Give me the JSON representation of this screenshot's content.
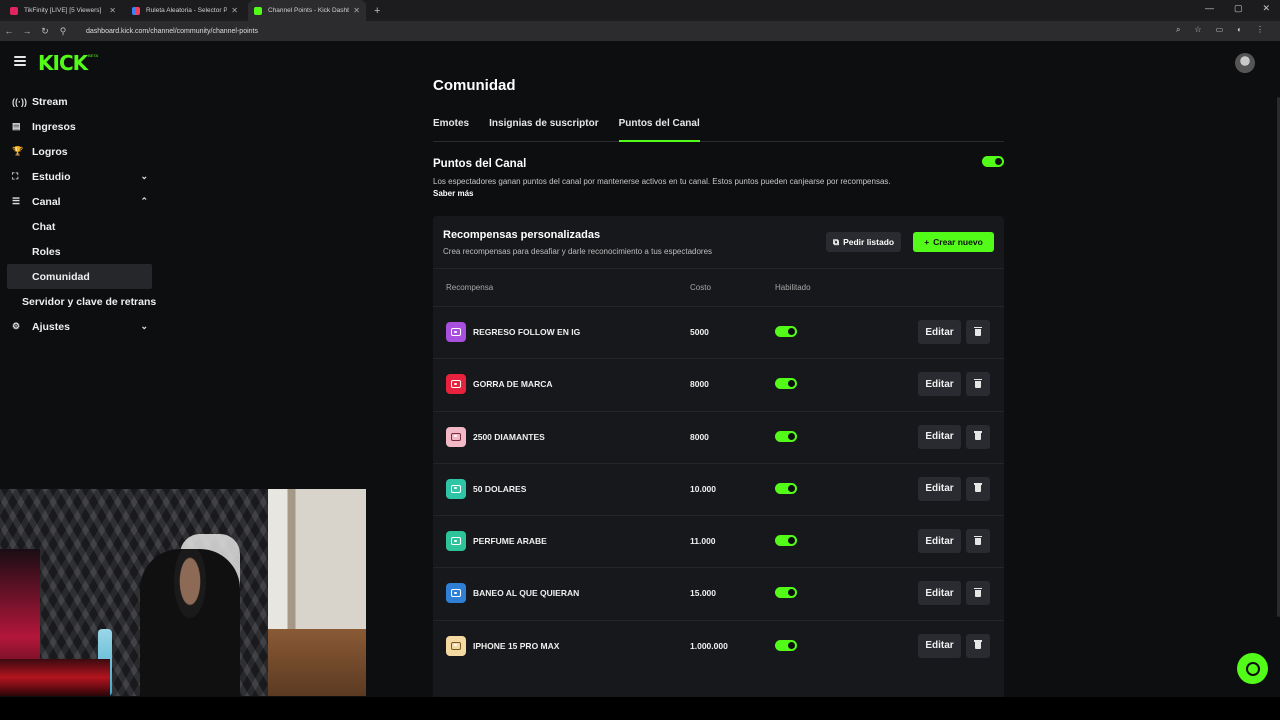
{
  "browser": {
    "tabs": [
      {
        "title": "TikFinity [LIVE] [5 Viewers]",
        "color": "#e0245e"
      },
      {
        "title": "Ruleta Aleatoria - Selector Pers",
        "color": "#3b82f6"
      },
      {
        "title": "Channel Points - Kick Dashboar",
        "color": "#53fc18"
      }
    ],
    "url": "dashboard.kick.com/channel/community/channel-points",
    "new_tab": "+",
    "min": "—",
    "max": "▢",
    "close": "✕"
  },
  "app": {
    "logo": "KICK",
    "beta": "BETA"
  },
  "sidebar": {
    "items": [
      {
        "label": "Stream",
        "icon": "((·))"
      },
      {
        "label": "Ingresos",
        "icon": "▤"
      },
      {
        "label": "Logros",
        "icon": "🏆"
      },
      {
        "label": "Estudio",
        "icon": "⛶",
        "chevron": "⌄"
      },
      {
        "label": "Canal",
        "icon": "☰",
        "chevron": "⌃"
      }
    ],
    "canal_sub": [
      "Chat",
      "Roles",
      "Comunidad"
    ],
    "extra": "Servidor y clave de retrans",
    "settings": {
      "label": "Ajustes",
      "icon": "⚙",
      "chevron": "⌄"
    }
  },
  "main": {
    "title": "Comunidad",
    "tabs": [
      "Emotes",
      "Insignias de suscriptor",
      "Puntos del Canal"
    ],
    "cp_title": "Puntos del Canal",
    "cp_desc": "Los espectadores ganan puntos del canal por mantenerse activos en tu canal. Estos puntos pueden canjearse por recompensas.",
    "cp_more": "Saber más",
    "rewards_title": "Recompensas personalizadas",
    "rewards_sub": "Crea recompensas para desafiar y darle reconocimiento a tus espectadores",
    "btn_list": "Pedir listado",
    "btn_new": "Crear nuevo",
    "col_reward": "Recompensa",
    "col_cost": "Costo",
    "col_enabled": "Habilitado",
    "edit_label": "Editar",
    "rewards": [
      {
        "name": "REGRESO FOLLOW EN IG",
        "cost": "5000",
        "color": "#a94fe0",
        "enabled": true
      },
      {
        "name": "GORRA DE MARCA",
        "cost": "8000",
        "color": "#e8213e",
        "enabled": true
      },
      {
        "name": "2500 DIAMANTES",
        "cost": "8000",
        "color": "#f2b8c6",
        "enabled": true
      },
      {
        "name": "50 DOLARES",
        "cost": "10.000",
        "color": "#2ec4a6",
        "enabled": true
      },
      {
        "name": "PERFUME ARABE",
        "cost": "11.000",
        "color": "#2ec49a",
        "enabled": true
      },
      {
        "name": "BANEO AL QUE QUIERAN",
        "cost": "15.000",
        "color": "#2f7fd6",
        "enabled": true
      },
      {
        "name": "IPHONE 15 PRO MAX",
        "cost": "1.000.000",
        "color": "#f5d9a3",
        "enabled": true
      }
    ]
  },
  "colors": {
    "accent": "#53fc18",
    "background": "#0d0e10",
    "card": "#17181b"
  }
}
